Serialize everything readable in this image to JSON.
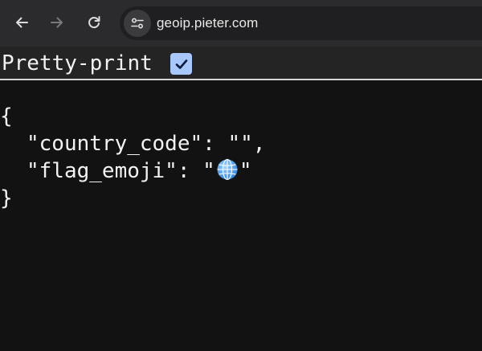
{
  "browser": {
    "url": "geoip.pieter.com",
    "icons": {
      "back": "back-arrow-icon",
      "forward": "forward-arrow-icon",
      "reload": "reload-icon",
      "site_info": "site-controls-icon"
    }
  },
  "page": {
    "pretty_print_label": "Pretty-print",
    "pretty_print_checked": true,
    "json": {
      "open_brace": "{",
      "country_code_key": "\"country_code\"",
      "colon": ": ",
      "country_code_value": "\"\"",
      "comma": ",",
      "flag_emoji_key": "\"flag_emoji\"",
      "quote": "\"",
      "flag_emoji_icon": "globe-icon",
      "close_brace": "}"
    }
  },
  "colors": {
    "toolbar_bg": "#2b2b2d",
    "omnibox_bg": "#1f1f21",
    "page_bg": "#121212",
    "checkbox_bg": "#a8c7fa",
    "text": "#f2f2f2"
  }
}
